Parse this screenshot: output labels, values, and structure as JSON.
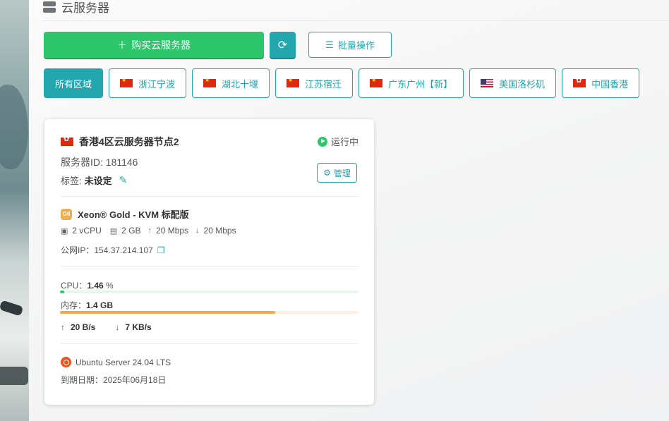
{
  "header": {
    "title": "云服务器"
  },
  "toolbar": {
    "buy_label": "购买云服务器",
    "batch_label": "批量操作"
  },
  "regions": [
    {
      "label": "所有区域",
      "flag": ""
    },
    {
      "label": "浙江宁波",
      "flag": "cn"
    },
    {
      "label": "湖北十堰",
      "flag": "cn"
    },
    {
      "label": "江苏宿迁",
      "flag": "cn"
    },
    {
      "label": "广东广州【新】",
      "flag": "cn"
    },
    {
      "label": "美国洛杉矶",
      "flag": "us"
    },
    {
      "label": "中国香港",
      "flag": "hk"
    }
  ],
  "server": {
    "name": "香港4区云服务器节点2",
    "status": "运行中",
    "id_label": "服务器ID: 181146",
    "tag_label": "标签:",
    "tag_value": "未设定",
    "manage_label": "管理",
    "cpu_model": "Xeon® Gold - KVM 标配版",
    "cpu_badge": "G6",
    "vcpu": "2 vCPU",
    "ram": "2 GB",
    "up_bw": "20 Mbps",
    "down_bw": "20 Mbps",
    "public_ip_label": "公网IP：",
    "public_ip": "154.37.214.107",
    "cpu_usage_label": "CPU：",
    "cpu_usage_value": "1.46",
    "cpu_usage_unit": " %",
    "cpu_usage_fraction": 0.0146,
    "mem_label": "内存：",
    "mem_value": "1.4 GB",
    "mem_usage_fraction": 0.72,
    "traffic_up": "20 B/s",
    "traffic_down": "7 KB/s",
    "os": "Ubuntu Server 24.04 LTS",
    "expire_label": "到期日期：",
    "expire_date": "2025年06月18日"
  },
  "colors": {
    "primary": "#23a6ad",
    "success": "#2dc66b",
    "warning": "#f0ad4e"
  }
}
